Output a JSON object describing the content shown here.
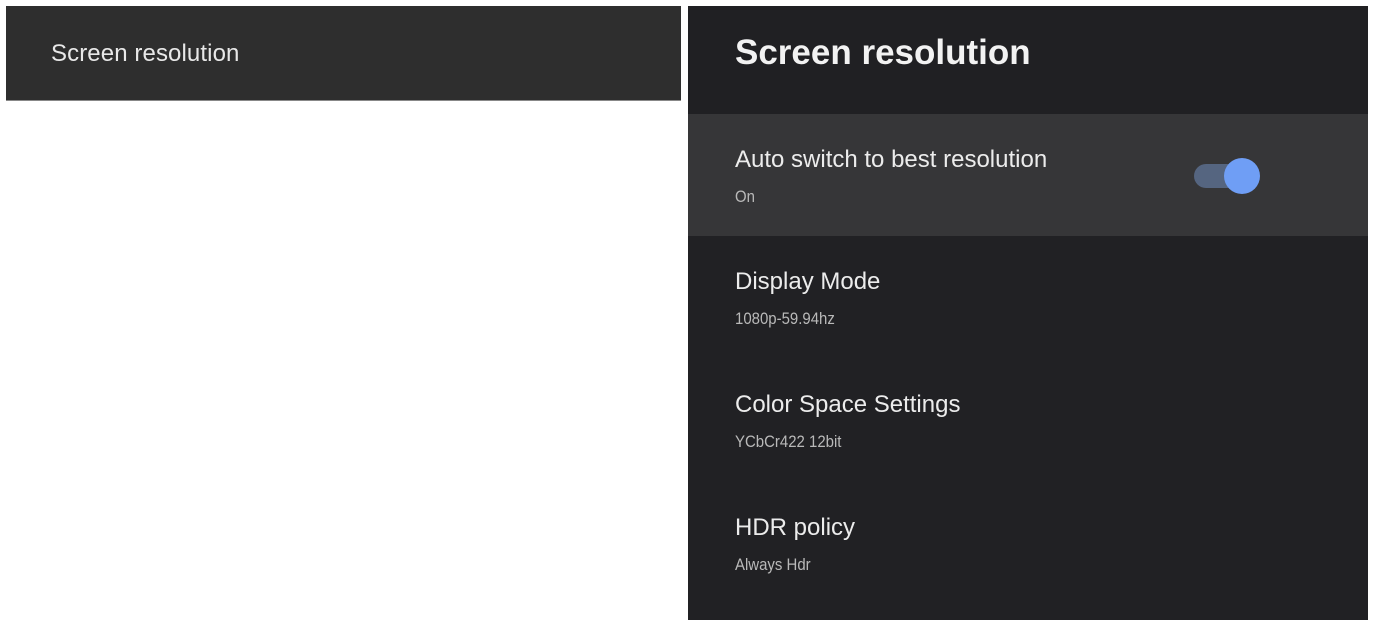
{
  "left": {
    "header_title": "Screen resolution"
  },
  "right": {
    "header_title": "Screen resolution",
    "settings": [
      {
        "title": "Auto switch to best resolution",
        "value": "On",
        "toggle_on": true,
        "focused": true
      },
      {
        "title": "Display Mode",
        "value": "1080p-59.94hz"
      },
      {
        "title": "Color Space Settings",
        "value": "YCbCr422 12bit"
      },
      {
        "title": "HDR policy",
        "value": "Always Hdr"
      }
    ]
  },
  "colors": {
    "toggle_thumb": "#6f9ef5",
    "toggle_track": "#556580",
    "panel_bg": "#212124",
    "focused_row_bg": "#363638"
  },
  "icons": {
    "toggle": "toggle-switch-on"
  }
}
